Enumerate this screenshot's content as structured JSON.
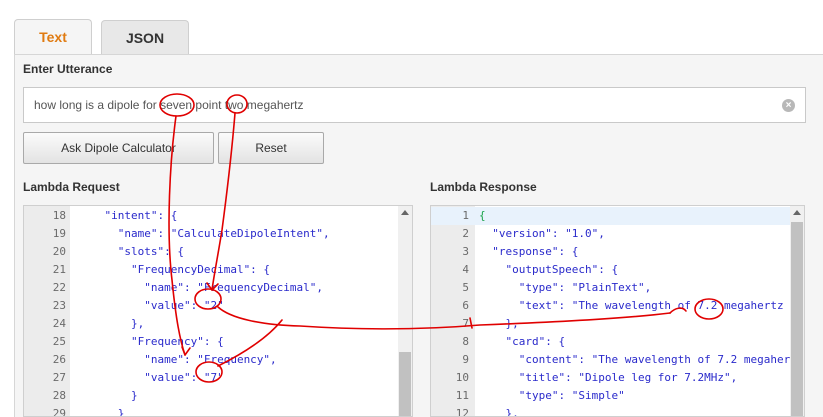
{
  "tabs": [
    {
      "label": "Text",
      "active": true
    },
    {
      "label": "JSON",
      "active": false
    }
  ],
  "utterance": {
    "label": "Enter Utterance",
    "value": "how long is a dipole for seven point two megahertz"
  },
  "buttons": {
    "ask": "Ask Dipole Calculator",
    "reset": "Reset"
  },
  "request": {
    "label": "Lambda Request",
    "lines": [
      {
        "n": "18",
        "text": "    \"intent\": {"
      },
      {
        "n": "19",
        "text": "      \"name\": \"CalculateDipoleIntent\","
      },
      {
        "n": "20",
        "text": "      \"slots\": {"
      },
      {
        "n": "21",
        "text": "        \"FrequencyDecimal\": {"
      },
      {
        "n": "22",
        "text": "          \"name\": \"FrequencyDecimal\","
      },
      {
        "n": "23",
        "text": "          \"value\": \"2\""
      },
      {
        "n": "24",
        "text": "        },"
      },
      {
        "n": "25",
        "text": "        \"Frequency\": {"
      },
      {
        "n": "26",
        "text": "          \"name\": \"Frequency\","
      },
      {
        "n": "27",
        "text": "          \"value\": \"7\""
      },
      {
        "n": "28",
        "text": "        }"
      },
      {
        "n": "29",
        "text": "      }"
      }
    ]
  },
  "response": {
    "label": "Lambda Response",
    "lines": [
      {
        "n": "1",
        "text": "{"
      },
      {
        "n": "2",
        "text": "  \"version\": \"1.0\","
      },
      {
        "n": "3",
        "text": "  \"response\": {"
      },
      {
        "n": "4",
        "text": "    \"outputSpeech\": {"
      },
      {
        "n": "5",
        "text": "      \"type\": \"PlainText\","
      },
      {
        "n": "6",
        "text": "      \"text\": \"The wavelength of 7.2 megahertz"
      },
      {
        "n": "7",
        "text": "    },"
      },
      {
        "n": "8",
        "text": "    \"card\": {"
      },
      {
        "n": "9",
        "text": "      \"content\": \"The wavelength of 7.2 megaher"
      },
      {
        "n": "10",
        "text": "      \"title\": \"Dipole leg for 7.2MHz\","
      },
      {
        "n": "11",
        "text": "      \"type\": \"Simple\""
      },
      {
        "n": "12",
        "text": "    },"
      }
    ]
  },
  "colors": {
    "accent_tab": "#e07b12",
    "json_text": "#2a2acb",
    "annotation": "#e00000"
  },
  "icons": {
    "clear": "clear-circle-x-icon",
    "scroll_up": "chevron-up-icon"
  }
}
